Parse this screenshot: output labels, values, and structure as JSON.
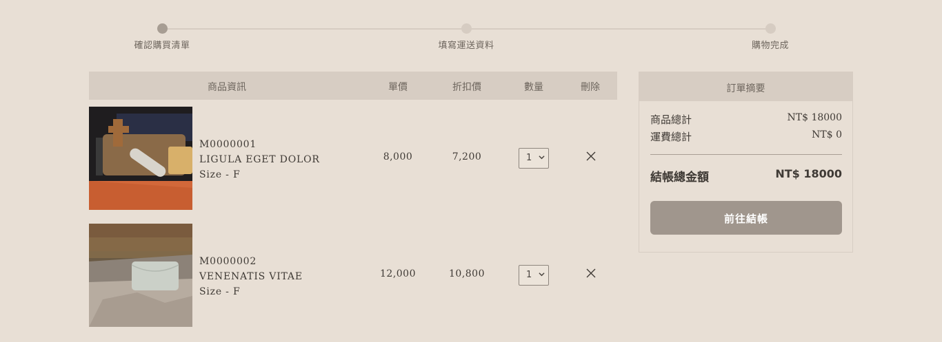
{
  "steps": [
    {
      "label": "確認購買清單",
      "active": true
    },
    {
      "label": "填寫運送資料",
      "active": false
    },
    {
      "label": "購物完成",
      "active": false
    }
  ],
  "table": {
    "headers": {
      "info": "商品資訊",
      "price": "單價",
      "discount": "折扣價",
      "qty": "數量",
      "delete": "刪除"
    },
    "items": [
      {
        "code": "M0000001",
        "name": "LIGULA EGET DOLOR",
        "size": "Size - F",
        "price": "8,000",
        "discount": "7,200",
        "qty": "1",
        "image": "leather-goods-photo"
      },
      {
        "code": "M0000002",
        "name": "VENENATIS VITAE",
        "size": "Size - F",
        "price": "12,000",
        "discount": "10,800",
        "qty": "1",
        "image": "leather-pouch-on-rock-photo"
      }
    ]
  },
  "summary": {
    "title": "訂單摘要",
    "subtotal_label": "商品總計",
    "subtotal_value": "NT$ 18000",
    "shipping_label": "運費總計",
    "shipping_value": "NT$ 0",
    "total_label": "結帳總金額",
    "total_value": "NT$ 18000",
    "checkout_label": "前往結帳"
  },
  "icons": {
    "delete": "close-icon",
    "select": "chevron-down-icon"
  },
  "colors": {
    "background": "#e8dfd5",
    "header_bg": "#d7cdc3",
    "active_step": "#a79d93",
    "button": "#a0968d"
  }
}
